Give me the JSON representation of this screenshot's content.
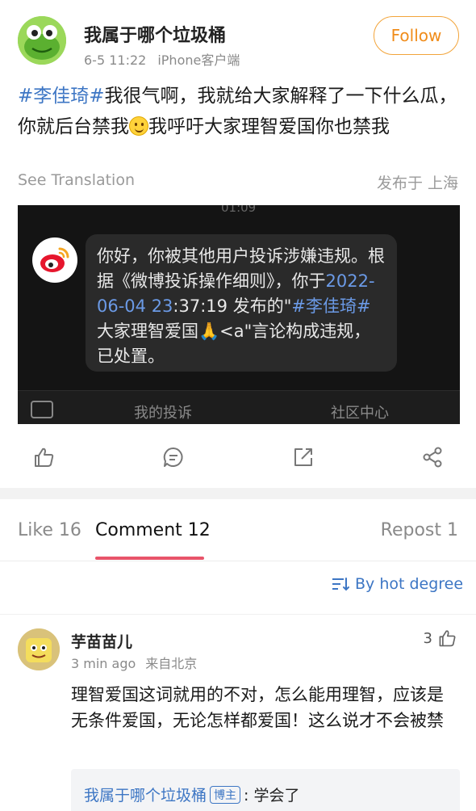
{
  "post": {
    "author": "我属于哪个垃圾桶",
    "date": "6-5 11:22",
    "source": "iPhone客户端",
    "follow_label": "Follow",
    "hashtag": "#李佳琦#",
    "text_part1": "我很气啊，我就给大家解释了一下什么瓜，你就后台禁我",
    "text_part2": "我呼吁大家理智爱国你也禁我",
    "see_translation": "See Translation",
    "location": "发布于 上海"
  },
  "screenshot": {
    "time": "01:09",
    "msg_line1": "你好，你被其他用户投诉涉嫌违规。根据《微博投诉操作细则》，你于",
    "msg_date": "2022-06-04 23",
    "msg_line2": ":37:19 发布的\"",
    "msg_tag": "#李佳琦#",
    "msg_line3": "大家理智爱国🙏<a\"言论构成违规，已处置。",
    "tab_complaint": "我的投诉",
    "tab_community": "社区中心"
  },
  "tabs": {
    "like": "Like 16",
    "comment": "Comment 12",
    "repost": "Repost 1"
  },
  "sort_label": "By hot degree",
  "comment": {
    "name": "芋苗苗儿",
    "time": "3 min ago",
    "from": "来自北京",
    "likes": "3",
    "text": "理智爱国这词就用的不对，怎么能用理智，应该是无条件爱国，无论怎样都爱国！这么说才不会被禁",
    "reply_name": "我属于哪个垃圾桶",
    "reply_badge": "博主",
    "reply_text": ": 学会了"
  }
}
